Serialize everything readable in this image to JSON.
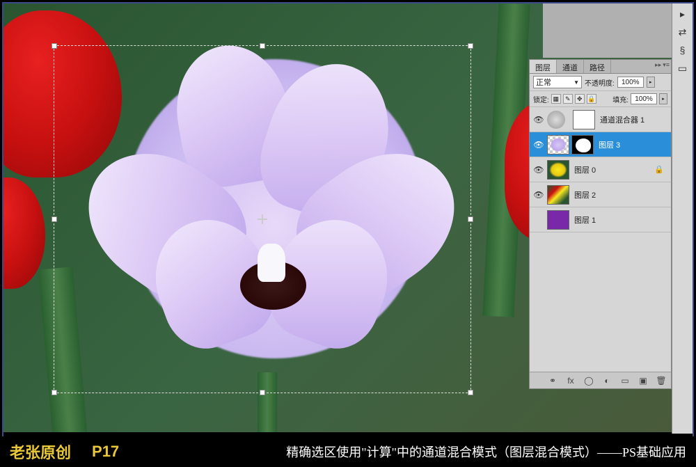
{
  "caption": {
    "author": "老张原创",
    "page": "P17",
    "description": "精确选区使用\"计算\"中的通道混合模式（图层混合模式）——PS基础应用"
  },
  "panel": {
    "tabs": [
      "图层",
      "通道",
      "路径"
    ],
    "blend_mode": "正常",
    "opacity_label": "不透明度:",
    "opacity_value": "100%",
    "lock_label": "锁定:",
    "fill_label": "填充:",
    "fill_value": "100%"
  },
  "layers": [
    {
      "name": "通道混合器 1",
      "type": "adjustment",
      "visible": true,
      "selected": false
    },
    {
      "name": "图层 3",
      "type": "masked",
      "visible": true,
      "selected": true
    },
    {
      "name": "图层 0",
      "type": "normal",
      "visible": true,
      "selected": false,
      "locked": true
    },
    {
      "name": "图层 2",
      "type": "normal",
      "visible": true,
      "selected": false
    },
    {
      "name": "图层 1",
      "type": "normal",
      "visible": false,
      "selected": false
    }
  ],
  "footer_icons": [
    "fx",
    "mask",
    "adjust",
    "folder",
    "new",
    "trash"
  ]
}
